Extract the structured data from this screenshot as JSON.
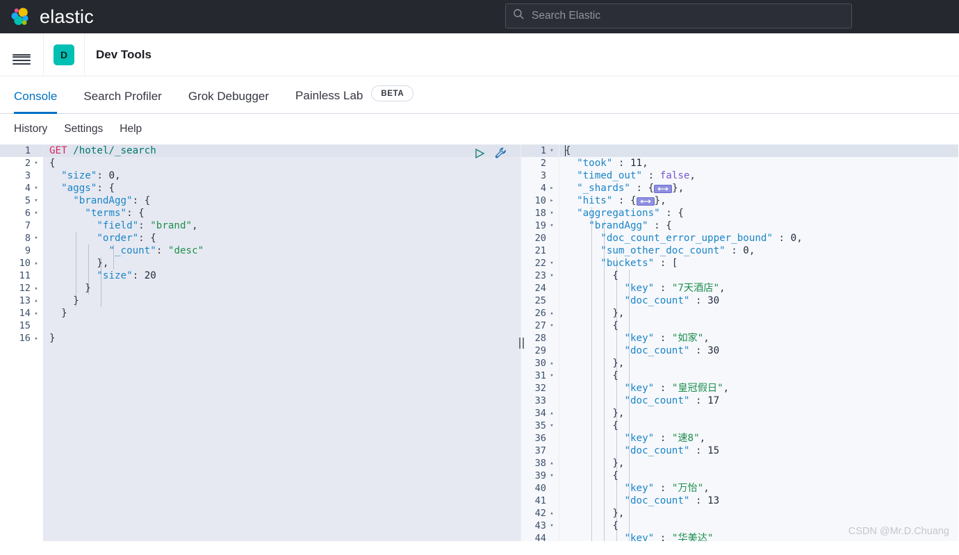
{
  "colors": {
    "chrome_bg": "#25282f",
    "accent_blue": "#0071c2",
    "teal_badge": "#00bfb3",
    "editor_bg": "#e7e9f2",
    "response_bg": "#f7f8fc",
    "logo_yellow": "#f0c000",
    "logo_teal": "#00bfb3",
    "logo_blue": "#1ba9f5",
    "logo_pink": "#f04e98",
    "logo_green": "#93c90e"
  },
  "topbar": {
    "brand_name": "elastic",
    "logo_icon": "elastic-logo-icon",
    "search": {
      "icon": "search-icon",
      "placeholder": "Search Elastic",
      "value": ""
    }
  },
  "appheader": {
    "menu_icon": "hamburger-menu-icon",
    "app_badge": "D",
    "app_title": "Dev Tools"
  },
  "tabs": [
    {
      "label": "Console",
      "active": true,
      "badge": ""
    },
    {
      "label": "Search Profiler",
      "active": false,
      "badge": ""
    },
    {
      "label": "Grok Debugger",
      "active": false,
      "badge": ""
    },
    {
      "label": "Painless Lab",
      "active": false,
      "badge": "BETA"
    }
  ],
  "submenu": [
    {
      "label": "History"
    },
    {
      "label": "Settings"
    },
    {
      "label": "Help"
    }
  ],
  "request_editor": {
    "play_icon": "play-triangle-icon",
    "wrench_icon": "wrench-icon",
    "active_line": 1,
    "method": "GET",
    "path": "/hotel/_search",
    "lines": [
      {
        "n": 1,
        "fold": "",
        "text": "GET /hotel/_search"
      },
      {
        "n": 2,
        "fold": "▾",
        "text": "{"
      },
      {
        "n": 3,
        "fold": "",
        "text": "  \"size\": 0,"
      },
      {
        "n": 4,
        "fold": "▾",
        "text": "  \"aggs\": {"
      },
      {
        "n": 5,
        "fold": "▾",
        "text": "    \"brandAgg\": {"
      },
      {
        "n": 6,
        "fold": "▾",
        "text": "      \"terms\": {"
      },
      {
        "n": 7,
        "fold": "",
        "text": "        \"field\": \"brand\","
      },
      {
        "n": 8,
        "fold": "▾",
        "text": "        \"order\": {"
      },
      {
        "n": 9,
        "fold": "",
        "text": "          \"_count\": \"desc\""
      },
      {
        "n": 10,
        "fold": "▴",
        "text": "        },"
      },
      {
        "n": 11,
        "fold": "",
        "text": "        \"size\": 20"
      },
      {
        "n": 12,
        "fold": "▴",
        "text": "      }"
      },
      {
        "n": 13,
        "fold": "▴",
        "text": "    }"
      },
      {
        "n": 14,
        "fold": "▴",
        "text": "  }"
      },
      {
        "n": 15,
        "fold": "",
        "text": ""
      },
      {
        "n": 16,
        "fold": "▴",
        "text": "}"
      }
    ],
    "json_body": {
      "size": 0,
      "aggs": {
        "brandAgg": {
          "terms": {
            "field": "brand",
            "order": {
              "_count": "desc"
            },
            "size": 20
          }
        }
      }
    }
  },
  "response_editor": {
    "active_line": 1,
    "lines": [
      {
        "n": 1,
        "fold": "▾",
        "text": "{"
      },
      {
        "n": 2,
        "fold": "",
        "text": "  \"took\" : 11,"
      },
      {
        "n": 3,
        "fold": "",
        "text": "  \"timed_out\" : false,"
      },
      {
        "n": 4,
        "fold": "▸",
        "text": "  \"_shards\" : {⟷},"
      },
      {
        "n": 10,
        "fold": "▸",
        "text": "  \"hits\" : {⟷},"
      },
      {
        "n": 18,
        "fold": "▾",
        "text": "  \"aggregations\" : {"
      },
      {
        "n": 19,
        "fold": "▾",
        "text": "    \"brandAgg\" : {"
      },
      {
        "n": 20,
        "fold": "",
        "text": "      \"doc_count_error_upper_bound\" : 0,"
      },
      {
        "n": 21,
        "fold": "",
        "text": "      \"sum_other_doc_count\" : 0,"
      },
      {
        "n": 22,
        "fold": "▾",
        "text": "      \"buckets\" : ["
      },
      {
        "n": 23,
        "fold": "▾",
        "text": "        {"
      },
      {
        "n": 24,
        "fold": "",
        "text": "          \"key\" : \"7天酒店\","
      },
      {
        "n": 25,
        "fold": "",
        "text": "          \"doc_count\" : 30"
      },
      {
        "n": 26,
        "fold": "▴",
        "text": "        },"
      },
      {
        "n": 27,
        "fold": "▾",
        "text": "        {"
      },
      {
        "n": 28,
        "fold": "",
        "text": "          \"key\" : \"如家\","
      },
      {
        "n": 29,
        "fold": "",
        "text": "          \"doc_count\" : 30"
      },
      {
        "n": 30,
        "fold": "▴",
        "text": "        },"
      },
      {
        "n": 31,
        "fold": "▾",
        "text": "        {"
      },
      {
        "n": 32,
        "fold": "",
        "text": "          \"key\" : \"皇冠假日\","
      },
      {
        "n": 33,
        "fold": "",
        "text": "          \"doc_count\" : 17"
      },
      {
        "n": 34,
        "fold": "▴",
        "text": "        },"
      },
      {
        "n": 35,
        "fold": "▾",
        "text": "        {"
      },
      {
        "n": 36,
        "fold": "",
        "text": "          \"key\" : \"速8\","
      },
      {
        "n": 37,
        "fold": "",
        "text": "          \"doc_count\" : 15"
      },
      {
        "n": 38,
        "fold": "▴",
        "text": "        },"
      },
      {
        "n": 39,
        "fold": "▾",
        "text": "        {"
      },
      {
        "n": 40,
        "fold": "",
        "text": "          \"key\" : \"万怡\","
      },
      {
        "n": 41,
        "fold": "",
        "text": "          \"doc_count\" : 13"
      },
      {
        "n": 42,
        "fold": "▴",
        "text": "        },"
      },
      {
        "n": 43,
        "fold": "▾",
        "text": "        {"
      },
      {
        "n": 44,
        "fold": "",
        "text": "          \"key\" : \"华美达\""
      }
    ],
    "values": {
      "took": 11,
      "timed_out": "false",
      "shards_collapsed": true,
      "hits_collapsed": true,
      "doc_count_error_upper_bound": 0,
      "sum_other_doc_count": 0,
      "buckets": [
        {
          "key": "7天酒店",
          "doc_count": 30
        },
        {
          "key": "如家",
          "doc_count": 30
        },
        {
          "key": "皇冠假日",
          "doc_count": 17
        },
        {
          "key": "速8",
          "doc_count": 15
        },
        {
          "key": "万怡",
          "doc_count": 13
        },
        {
          "key": "华美达",
          "doc_count": null
        }
      ]
    }
  },
  "splitter": {
    "handle_icon": "drag-handle-icon"
  },
  "watermark": {
    "text": "CSDN @Mr.D.Chuang"
  }
}
